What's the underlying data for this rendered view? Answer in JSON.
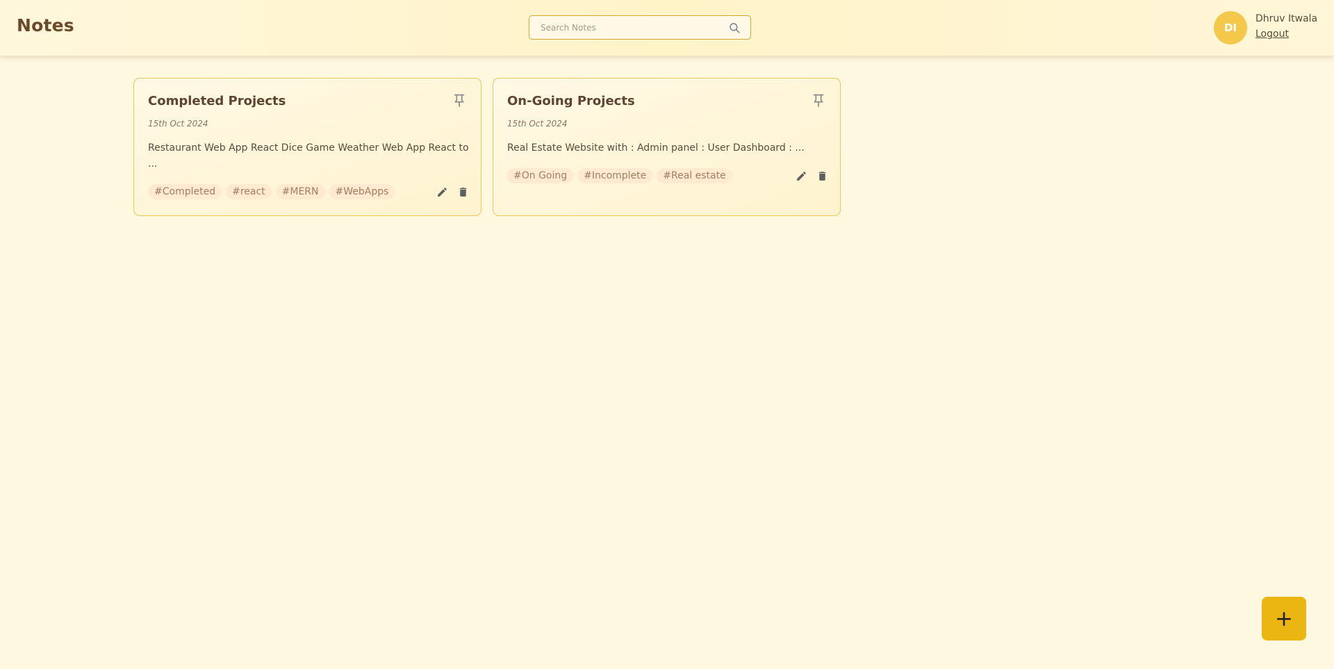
{
  "header": {
    "title": "Notes",
    "search": {
      "placeholder": "Search Notes",
      "value": ""
    },
    "user": {
      "initials": "DI",
      "name": "Dhruv Itwala",
      "logout_label": "Logout"
    }
  },
  "notes": [
    {
      "title": "Completed Projects",
      "date": "15th Oct 2024",
      "content": "Restaurant Web App React Dice Game Weather Web App React to ...",
      "tags": [
        "#Completed",
        "#react",
        "#MERN",
        "#WebApps"
      ]
    },
    {
      "title": "On-Going Projects",
      "date": "15th Oct 2024",
      "content": "Real Estate Website with : Admin panel : User Dashboard : ...",
      "tags": [
        "#On Going",
        "#Incomplete",
        "#Real estate"
      ]
    }
  ],
  "icons": {
    "search": "search-icon",
    "pin": "pin-icon",
    "edit": "pencil-icon",
    "delete": "trash-icon",
    "add": "plus-icon"
  },
  "colors": {
    "background": "#fff8e1",
    "accent": "#ebb512",
    "avatar": "#f3c84b",
    "card_border": "#e9c951",
    "title_text": "#6b4a2a"
  }
}
